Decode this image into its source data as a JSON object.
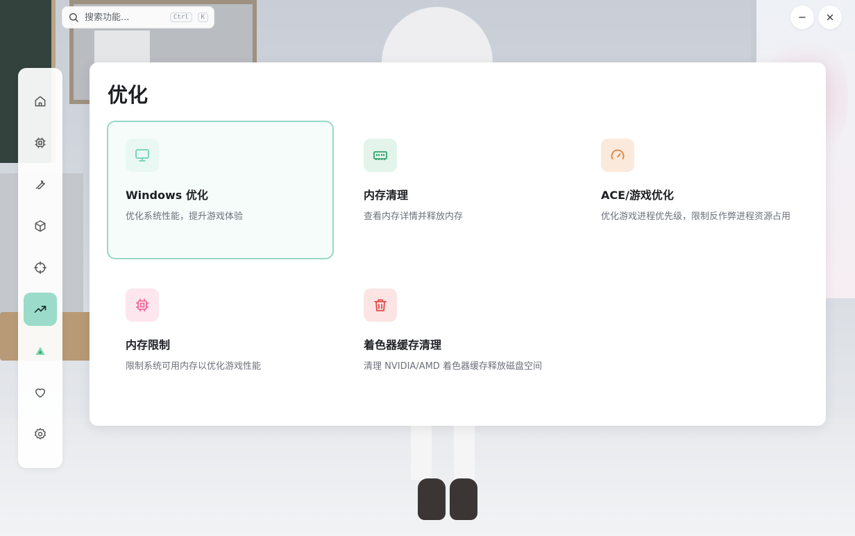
{
  "search": {
    "placeholder": "搜索功能...",
    "shortcut_ctrl": "Ctrl",
    "shortcut_key": "K"
  },
  "window_controls": {
    "minimize": "minimize",
    "close": "close"
  },
  "sidebar": {
    "items": [
      {
        "id": "home",
        "icon": "home-icon",
        "active": false
      },
      {
        "id": "hardware",
        "icon": "chip-icon",
        "active": false
      },
      {
        "id": "tools",
        "icon": "wrench-icon",
        "active": false
      },
      {
        "id": "packages",
        "icon": "box-icon",
        "active": false
      },
      {
        "id": "crosshair",
        "icon": "crosshair-icon",
        "active": false
      },
      {
        "id": "optimize",
        "icon": "trending-up-icon",
        "active": true
      },
      {
        "id": "brand",
        "icon": "triangle-logo-icon",
        "active": false
      },
      {
        "id": "favorites",
        "icon": "heart-icon",
        "active": false
      },
      {
        "id": "settings",
        "icon": "gear-icon",
        "active": false
      }
    ]
  },
  "main": {
    "title": "优化",
    "cards": [
      {
        "title": "Windows 优化",
        "desc": "优化系统性能，提升游戏体验",
        "icon": "monitor-icon",
        "color": "#6fcfb7",
        "bg": "#eaf8f3"
      },
      {
        "title": "内存清理",
        "desc": "查看内存详情并释放内存",
        "icon": "memory-icon",
        "color": "#2fa36b",
        "bg": "#e3f4ea"
      },
      {
        "title": "ACE/游戏优化",
        "desc": "优化游戏进程优先级，限制反作弊进程资源占用",
        "icon": "gauge-icon",
        "color": "#e0823a",
        "bg": "#fbeadc"
      },
      {
        "title": "内存限制",
        "desc": "限制系统可用内存以优化游戏性能",
        "icon": "cpu-icon",
        "color": "#f0689a",
        "bg": "#fde6ee"
      },
      {
        "title": "着色器缓存清理",
        "desc": "清理 NVIDIA/AMD 着色器缓存释放磁盘空间",
        "icon": "trash-icon",
        "color": "#e04848",
        "bg": "#fce4e4"
      }
    ]
  },
  "colors": {
    "accent": "#9adcc9",
    "selected_border": "#95d8c6"
  }
}
